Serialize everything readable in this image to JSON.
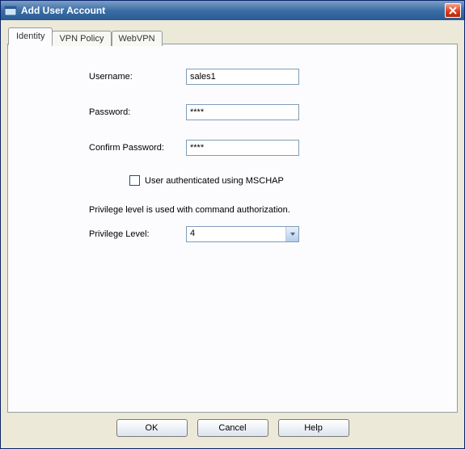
{
  "window": {
    "title": "Add User Account"
  },
  "tabs": [
    {
      "label": "Identity"
    },
    {
      "label": "VPN Policy"
    },
    {
      "label": "WebVPN"
    }
  ],
  "form": {
    "username_label": "Username:",
    "username_value": "sales1",
    "password_label": "Password:",
    "password_value": "****",
    "confirm_label": "Confirm Password:",
    "confirm_value": "****",
    "mschap_label": "User authenticated using MSCHAP",
    "mschap_checked": false,
    "privilege_note": "Privilege level is used with command authorization.",
    "privilege_label": "Privilege Level:",
    "privilege_value": "4"
  },
  "buttons": {
    "ok": "OK",
    "cancel": "Cancel",
    "help": "Help"
  }
}
